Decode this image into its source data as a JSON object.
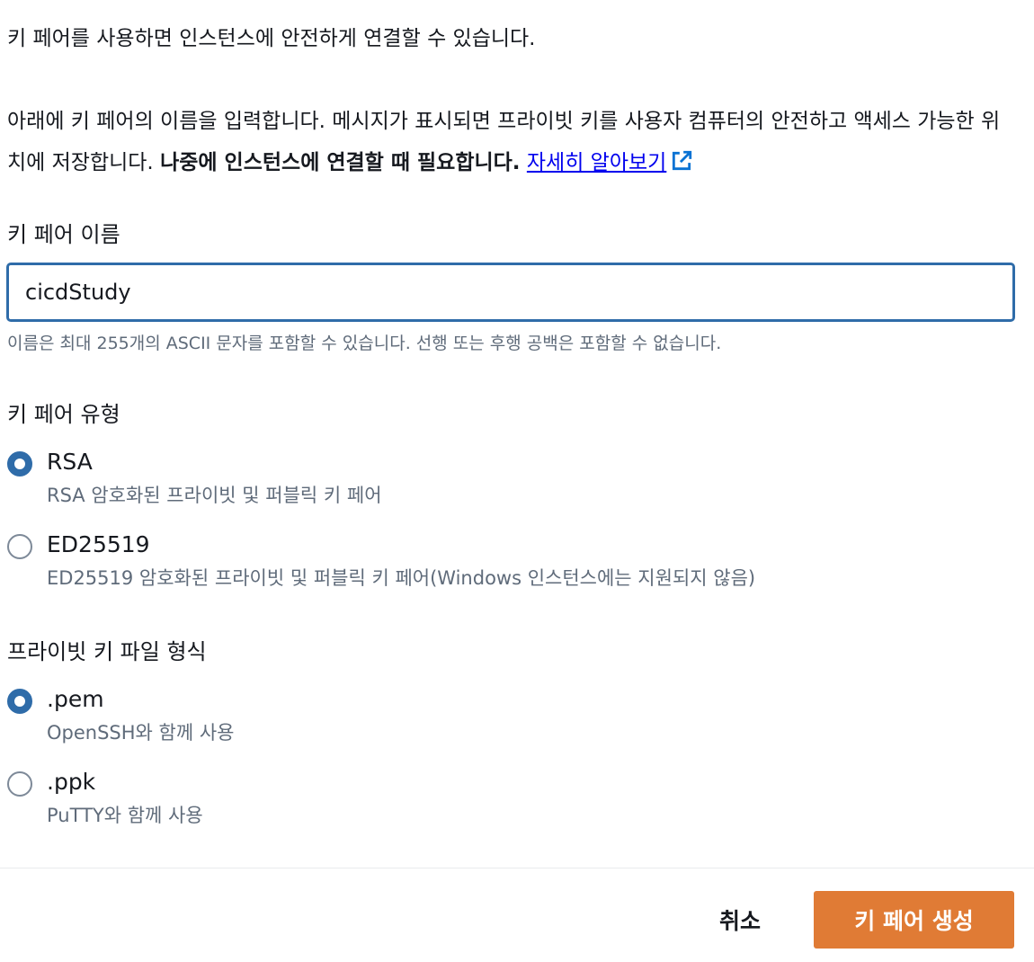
{
  "intro_text": "키 페어를 사용하면 인스턴스에 안전하게 연결할 수 있습니다.",
  "description": {
    "text": "아래에 키 페어의 이름을 입력합니다. 메시지가 표시되면 프라이빗 키를 사용자 컴퓨터의 안전하고 액세스 가능한 위치에 저장합니다. ",
    "bold_text": "나중에 인스턴스에 연결할 때 필요합니다.",
    "link_label": "자세히 알아보기",
    "link_icon": "external-link-icon"
  },
  "key_name": {
    "label": "키 페어 이름",
    "value": "cicdStudy",
    "hint": "이름은 최대 255개의 ASCII 문자를 포함할 수 있습니다. 선행 또는 후행 공백은 포함할 수 없습니다."
  },
  "key_type": {
    "label": "키 페어 유형",
    "options": [
      {
        "label": "RSA",
        "description": "RSA 암호화된 프라이빗 및 퍼블릭 키 페어",
        "selected": true
      },
      {
        "label": "ED25519",
        "description": "ED25519 암호화된 프라이빗 및 퍼블릭 키 페어(Windows 인스턴스에는 지원되지 않음)",
        "selected": false
      }
    ]
  },
  "file_format": {
    "label": "프라이빗 키 파일 형식",
    "options": [
      {
        "label": ".pem",
        "description": "OpenSSH와 함께 사용",
        "selected": true
      },
      {
        "label": ".ppk",
        "description": "PuTTY와 함께 사용",
        "selected": false
      }
    ]
  },
  "footer": {
    "cancel_label": "취소",
    "create_label": "키 페어 생성"
  },
  "colors": {
    "accent": "#2f6ca9",
    "primary_button": "#e07b35",
    "link": "#0000ee",
    "secondary_text": "#5f6b7a"
  }
}
